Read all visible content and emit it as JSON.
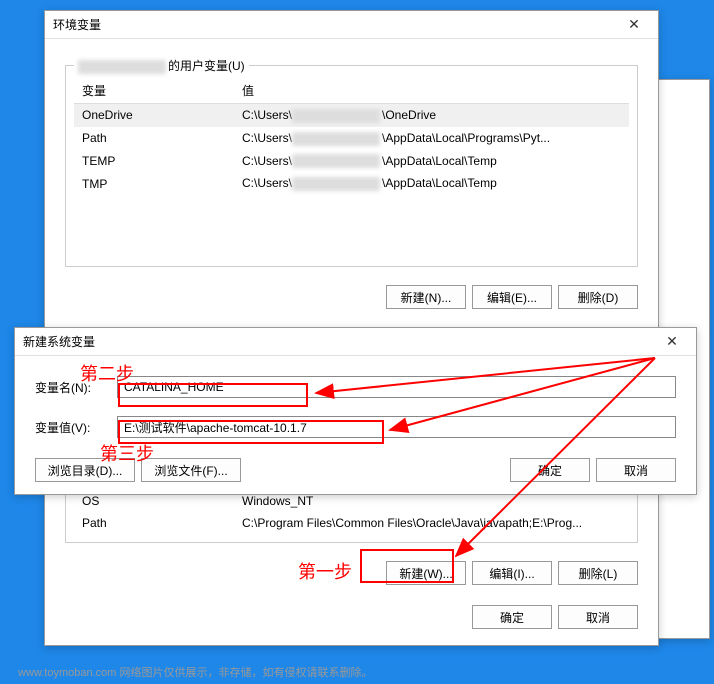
{
  "window_back": {
    "visible": true
  },
  "env_window": {
    "title": "环境变量",
    "user_group_suffix": "的用户变量(U)",
    "headers": {
      "var": "变量",
      "val": "值"
    },
    "user_vars": [
      {
        "name": "OneDrive",
        "value_prefix": "C:\\Users\\",
        "value_suffix": "\\OneDrive",
        "sel": true
      },
      {
        "name": "Path",
        "value_prefix": "C:\\Users\\",
        "value_suffix": "\\AppData\\Local\\Programs\\Pyt...",
        "sel": false
      },
      {
        "name": "TEMP",
        "value_prefix": "C:\\Users\\",
        "value_suffix": "\\AppData\\Local\\Temp",
        "sel": false
      },
      {
        "name": "TMP",
        "value_prefix": "C:\\Users\\",
        "value_suffix": "\\AppData\\Local\\Temp",
        "sel": false
      }
    ],
    "user_buttons": {
      "new": "新建(N)...",
      "edit": "编辑(E)...",
      "delete": "删除(D)"
    },
    "sys_vars": [
      {
        "name": "OS",
        "value": "Windows_NT"
      },
      {
        "name": "Path",
        "value": "C:\\Program Files\\Common Files\\Oracle\\Java\\javapath;E:\\Prog..."
      }
    ],
    "sys_buttons": {
      "new": "新建(W)...",
      "edit": "编辑(I)...",
      "delete": "删除(L)"
    },
    "footer": {
      "ok": "确定",
      "cancel": "取消"
    }
  },
  "new_var_dialog": {
    "title": "新建系统变量",
    "name_label": "变量名(N):",
    "name_value": "CATALINA_HOME",
    "value_label": "变量值(V):",
    "value_value": "E:\\测试软件\\apache-tomcat-10.1.7",
    "browse_dir": "浏览目录(D)...",
    "browse_file": "浏览文件(F)...",
    "ok": "确定",
    "cancel": "取消"
  },
  "annotations": {
    "step1": "第一步",
    "step2": "第二步",
    "step3": "第三步"
  },
  "watermark": "www.toymoban.com 网络图片仅供展示，非存储，如有侵权请联系删除。"
}
